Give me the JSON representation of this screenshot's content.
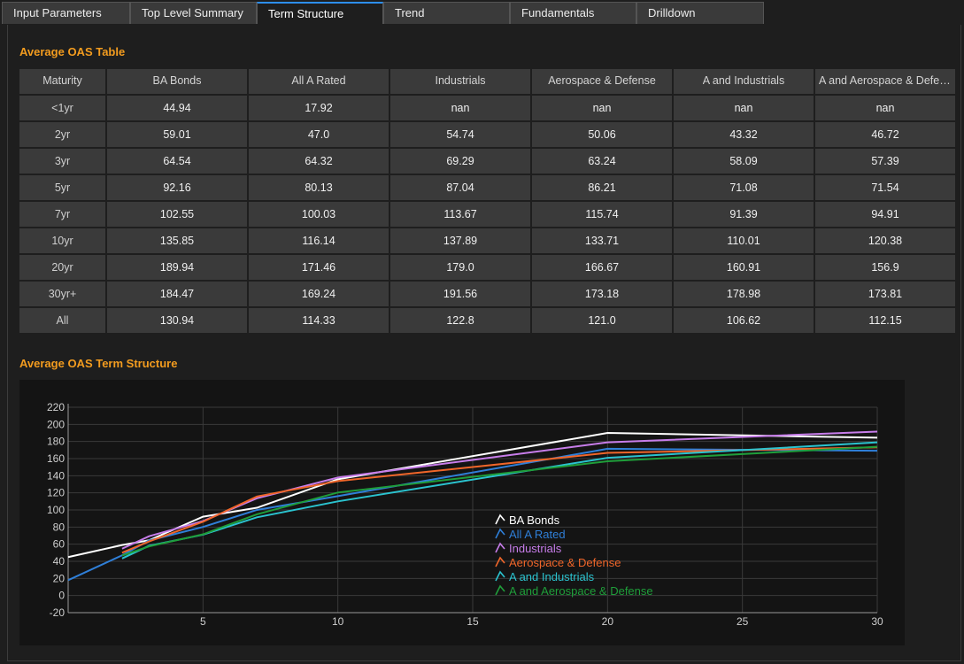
{
  "tabs": [
    {
      "label": "Input Parameters",
      "active": false
    },
    {
      "label": "Top Level Summary",
      "active": false
    },
    {
      "label": "Term Structure",
      "active": true
    },
    {
      "label": "Trend",
      "active": false
    },
    {
      "label": "Fundamentals",
      "active": false
    },
    {
      "label": "Drilldown",
      "active": false
    }
  ],
  "table": {
    "title": "Average OAS Table",
    "headers": [
      "Maturity",
      "BA Bonds",
      "All A Rated",
      "Industrials",
      "Aerospace & Defense",
      "A and Industrials",
      "A and Aerospace & Defense"
    ],
    "rows": [
      [
        "<1yr",
        "44.94",
        "17.92",
        "nan",
        "nan",
        "nan",
        "nan"
      ],
      [
        "2yr",
        "59.01",
        "47.0",
        "54.74",
        "50.06",
        "43.32",
        "46.72"
      ],
      [
        "3yr",
        "64.54",
        "64.32",
        "69.29",
        "63.24",
        "58.09",
        "57.39"
      ],
      [
        "5yr",
        "92.16",
        "80.13",
        "87.04",
        "86.21",
        "71.08",
        "71.54"
      ],
      [
        "7yr",
        "102.55",
        "100.03",
        "113.67",
        "115.74",
        "91.39",
        "94.91"
      ],
      [
        "10yr",
        "135.85",
        "116.14",
        "137.89",
        "133.71",
        "110.01",
        "120.38"
      ],
      [
        "20yr",
        "189.94",
        "171.46",
        "179.0",
        "166.67",
        "160.91",
        "156.9"
      ],
      [
        "30yr+",
        "184.47",
        "169.24",
        "191.56",
        "173.18",
        "178.98",
        "173.81"
      ],
      [
        "All",
        "130.94",
        "114.33",
        "122.8",
        "121.0",
        "106.62",
        "112.15"
      ]
    ]
  },
  "chart": {
    "title": "Average OAS Term Structure"
  },
  "chart_data": {
    "type": "line",
    "xlim": [
      0,
      30
    ],
    "ylim": [
      -20,
      220
    ],
    "xticks": [
      5,
      10,
      15,
      20,
      25,
      30
    ],
    "yticks": [
      -20,
      0,
      20,
      40,
      60,
      80,
      100,
      120,
      140,
      160,
      180,
      200,
      220
    ],
    "grid": true,
    "legend_position": "center",
    "x": [
      0,
      2,
      3,
      5,
      7,
      10,
      20,
      30
    ],
    "series": [
      {
        "name": "BA Bonds",
        "color": "#ffffff",
        "values": [
          44.94,
          59.01,
          64.54,
          92.16,
          102.55,
          135.85,
          189.94,
          184.47
        ]
      },
      {
        "name": "All A Rated",
        "color": "#2f7fd8",
        "values": [
          17.92,
          47.0,
          64.32,
          80.13,
          100.03,
          116.14,
          171.46,
          169.24
        ]
      },
      {
        "name": "Industrials",
        "color": "#c77dea",
        "values": [
          null,
          54.74,
          69.29,
          87.04,
          113.67,
          137.89,
          179.0,
          191.56
        ]
      },
      {
        "name": "Aerospace & Defense",
        "color": "#f0662a",
        "values": [
          null,
          50.06,
          63.24,
          86.21,
          115.74,
          133.71,
          166.67,
          173.18
        ]
      },
      {
        "name": "A and Industrials",
        "color": "#2bc3cf",
        "values": [
          null,
          43.32,
          58.09,
          71.08,
          91.39,
          110.01,
          160.91,
          178.98
        ]
      },
      {
        "name": "A and Aerospace & Defense",
        "color": "#1f9e3a",
        "values": [
          null,
          46.72,
          57.39,
          71.54,
          94.91,
          120.38,
          156.9,
          173.81
        ]
      }
    ]
  }
}
